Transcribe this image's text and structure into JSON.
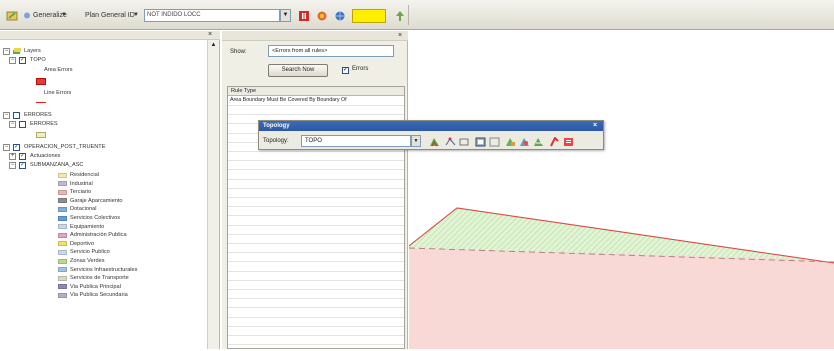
{
  "toolbar": {
    "generalize_label": "Generalize",
    "plan_label": "Plan General ID",
    "layer_combo_value": "NOT INDIDO LOCC"
  },
  "toc": {
    "root_label": "Layers",
    "groups": [
      {
        "label": "TOPO",
        "items": [
          {
            "label": "Area Errors",
            "color": "#e5393a"
          },
          {
            "label": "Line Errors",
            "color": "#e02020"
          }
        ]
      },
      {
        "label": "ERRORES",
        "items": [
          {
            "label": "ERRORES",
            "color": "#f3ecbd"
          }
        ]
      },
      {
        "label": "OPERACION_POST_TRUENTE",
        "items": [
          {
            "label": "Actuaciones"
          },
          {
            "label": "SUBMANZANA_ASC"
          }
        ]
      }
    ],
    "legend": [
      {
        "label": "Residencial",
        "color": "#f7e8a8"
      },
      {
        "label": "Industrial",
        "color": "#c8b4d8"
      },
      {
        "label": "Terciario",
        "color": "#f0b3b3"
      },
      {
        "label": "Garaje Aparcamiento",
        "color": "#8e8e8e"
      },
      {
        "label": "Dotacional",
        "color": "#7fb0e0"
      },
      {
        "label": "Servicios Colectivos",
        "color": "#5aa0d8"
      },
      {
        "label": "Equipamiento",
        "color": "#c9d6ea"
      },
      {
        "label": "Administración Publica",
        "color": "#e8a2c6"
      },
      {
        "label": "Deportivo",
        "color": "#f3df64"
      },
      {
        "label": "Servicio Publico",
        "color": "#c8d8f0"
      },
      {
        "label": "Zonas Verdes",
        "color": "#b8dc8a"
      },
      {
        "label": "Servicios Infraestructurales",
        "color": "#9ec4e6"
      },
      {
        "label": "Servicios de Transporte",
        "color": "#d9d9c4"
      },
      {
        "label": "Via Publica Principal",
        "color": "#8a8ab8"
      },
      {
        "label": "Via Publica Secundaria",
        "color": "#b0b0cc"
      }
    ]
  },
  "inspector": {
    "show_label": "Show:",
    "show_value": "<Errors from all rules>",
    "search_button": "Search Now",
    "errors_checkbox": "Errors",
    "column_header": "Rule Type",
    "row_text": "Area Boundary Must Be Covered By Boundary Of"
  },
  "topology": {
    "title": "Topology",
    "label": "Topology:",
    "value": "TOPO"
  },
  "colors": {
    "polygon_fill": "#f8d9d6",
    "error_fill": "#d4efc4",
    "line_red": "#d94a4a"
  }
}
